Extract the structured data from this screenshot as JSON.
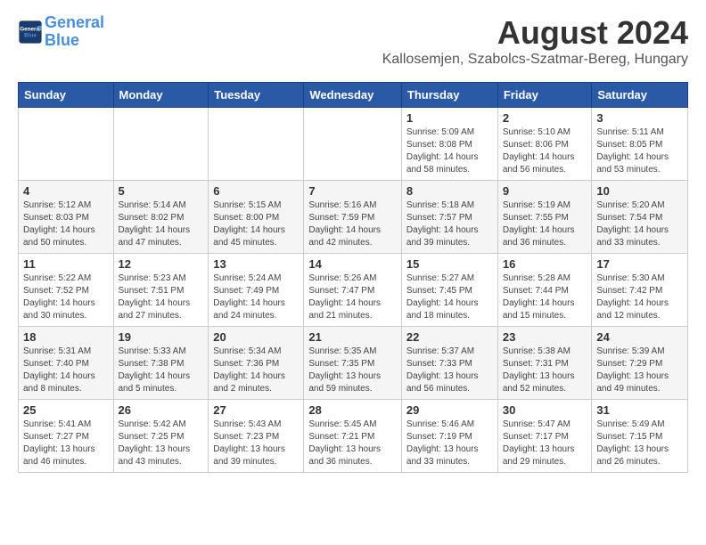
{
  "header": {
    "logo_line1": "General",
    "logo_line2": "Blue",
    "title": "August 2024",
    "subtitle": "Kallosemjen, Szabolcs-Szatmar-Bereg, Hungary"
  },
  "weekdays": [
    "Sunday",
    "Monday",
    "Tuesday",
    "Wednesday",
    "Thursday",
    "Friday",
    "Saturday"
  ],
  "weeks": [
    [
      {
        "day": "",
        "info": ""
      },
      {
        "day": "",
        "info": ""
      },
      {
        "day": "",
        "info": ""
      },
      {
        "day": "",
        "info": ""
      },
      {
        "day": "1",
        "info": "Sunrise: 5:09 AM\nSunset: 8:08 PM\nDaylight: 14 hours\nand 58 minutes."
      },
      {
        "day": "2",
        "info": "Sunrise: 5:10 AM\nSunset: 8:06 PM\nDaylight: 14 hours\nand 56 minutes."
      },
      {
        "day": "3",
        "info": "Sunrise: 5:11 AM\nSunset: 8:05 PM\nDaylight: 14 hours\nand 53 minutes."
      }
    ],
    [
      {
        "day": "4",
        "info": "Sunrise: 5:12 AM\nSunset: 8:03 PM\nDaylight: 14 hours\nand 50 minutes."
      },
      {
        "day": "5",
        "info": "Sunrise: 5:14 AM\nSunset: 8:02 PM\nDaylight: 14 hours\nand 47 minutes."
      },
      {
        "day": "6",
        "info": "Sunrise: 5:15 AM\nSunset: 8:00 PM\nDaylight: 14 hours\nand 45 minutes."
      },
      {
        "day": "7",
        "info": "Sunrise: 5:16 AM\nSunset: 7:59 PM\nDaylight: 14 hours\nand 42 minutes."
      },
      {
        "day": "8",
        "info": "Sunrise: 5:18 AM\nSunset: 7:57 PM\nDaylight: 14 hours\nand 39 minutes."
      },
      {
        "day": "9",
        "info": "Sunrise: 5:19 AM\nSunset: 7:55 PM\nDaylight: 14 hours\nand 36 minutes."
      },
      {
        "day": "10",
        "info": "Sunrise: 5:20 AM\nSunset: 7:54 PM\nDaylight: 14 hours\nand 33 minutes."
      }
    ],
    [
      {
        "day": "11",
        "info": "Sunrise: 5:22 AM\nSunset: 7:52 PM\nDaylight: 14 hours\nand 30 minutes."
      },
      {
        "day": "12",
        "info": "Sunrise: 5:23 AM\nSunset: 7:51 PM\nDaylight: 14 hours\nand 27 minutes."
      },
      {
        "day": "13",
        "info": "Sunrise: 5:24 AM\nSunset: 7:49 PM\nDaylight: 14 hours\nand 24 minutes."
      },
      {
        "day": "14",
        "info": "Sunrise: 5:26 AM\nSunset: 7:47 PM\nDaylight: 14 hours\nand 21 minutes."
      },
      {
        "day": "15",
        "info": "Sunrise: 5:27 AM\nSunset: 7:45 PM\nDaylight: 14 hours\nand 18 minutes."
      },
      {
        "day": "16",
        "info": "Sunrise: 5:28 AM\nSunset: 7:44 PM\nDaylight: 14 hours\nand 15 minutes."
      },
      {
        "day": "17",
        "info": "Sunrise: 5:30 AM\nSunset: 7:42 PM\nDaylight: 14 hours\nand 12 minutes."
      }
    ],
    [
      {
        "day": "18",
        "info": "Sunrise: 5:31 AM\nSunset: 7:40 PM\nDaylight: 14 hours\nand 8 minutes."
      },
      {
        "day": "19",
        "info": "Sunrise: 5:33 AM\nSunset: 7:38 PM\nDaylight: 14 hours\nand 5 minutes."
      },
      {
        "day": "20",
        "info": "Sunrise: 5:34 AM\nSunset: 7:36 PM\nDaylight: 14 hours\nand 2 minutes."
      },
      {
        "day": "21",
        "info": "Sunrise: 5:35 AM\nSunset: 7:35 PM\nDaylight: 13 hours\nand 59 minutes."
      },
      {
        "day": "22",
        "info": "Sunrise: 5:37 AM\nSunset: 7:33 PM\nDaylight: 13 hours\nand 56 minutes."
      },
      {
        "day": "23",
        "info": "Sunrise: 5:38 AM\nSunset: 7:31 PM\nDaylight: 13 hours\nand 52 minutes."
      },
      {
        "day": "24",
        "info": "Sunrise: 5:39 AM\nSunset: 7:29 PM\nDaylight: 13 hours\nand 49 minutes."
      }
    ],
    [
      {
        "day": "25",
        "info": "Sunrise: 5:41 AM\nSunset: 7:27 PM\nDaylight: 13 hours\nand 46 minutes."
      },
      {
        "day": "26",
        "info": "Sunrise: 5:42 AM\nSunset: 7:25 PM\nDaylight: 13 hours\nand 43 minutes."
      },
      {
        "day": "27",
        "info": "Sunrise: 5:43 AM\nSunset: 7:23 PM\nDaylight: 13 hours\nand 39 minutes."
      },
      {
        "day": "28",
        "info": "Sunrise: 5:45 AM\nSunset: 7:21 PM\nDaylight: 13 hours\nand 36 minutes."
      },
      {
        "day": "29",
        "info": "Sunrise: 5:46 AM\nSunset: 7:19 PM\nDaylight: 13 hours\nand 33 minutes."
      },
      {
        "day": "30",
        "info": "Sunrise: 5:47 AM\nSunset: 7:17 PM\nDaylight: 13 hours\nand 29 minutes."
      },
      {
        "day": "31",
        "info": "Sunrise: 5:49 AM\nSunset: 7:15 PM\nDaylight: 13 hours\nand 26 minutes."
      }
    ]
  ]
}
